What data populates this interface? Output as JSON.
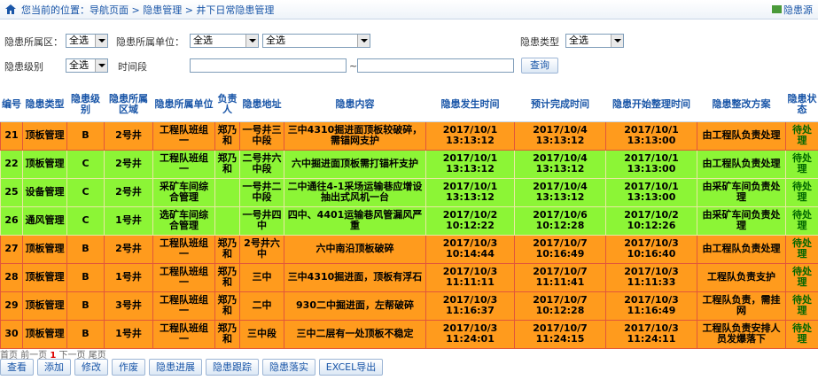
{
  "breadcrumb": "您当前的位置：导航页面 > 隐患管理 > 井下日常隐患管理",
  "top_link": "隐患源",
  "filters": {
    "area_label": "隐患所属区：",
    "area_value": "全选",
    "unit_label": "隐患所属单位：",
    "unit_value1": "全选",
    "unit_value2": "全选",
    "type_label": "隐患类型",
    "type_value": "全选",
    "level_label": "隐患级别",
    "level_value": "全选",
    "period_label": "时间段",
    "range_sep": "~",
    "query_label": "查询"
  },
  "columns": [
    "编号",
    "隐患类型",
    "隐患级别",
    "隐患所属区域",
    "隐患所属单位",
    "负责人",
    "隐患地址",
    "隐患内容",
    "隐患发生时间",
    "预计完成时间",
    "隐患开始整理时间",
    "隐患整改方案",
    "隐患状态"
  ],
  "rows": [
    {
      "style": "orange",
      "cells": [
        "21",
        "顶板管理",
        "B",
        "2号井",
        "工程队班组一",
        "郑乃和",
        "一号井三中段",
        "三中4310掘进面顶板较破碎，需锚网支护",
        "2017/10/1 13:13:12",
        "2017/10/4 13:13:12",
        "2017/10/1 13:13:00",
        "由工程队负责处理",
        "待处理"
      ]
    },
    {
      "style": "green",
      "cells": [
        "22",
        "顶板管理",
        "C",
        "2号井",
        "工程队班组一",
        "郑乃和",
        "二号井六中段",
        "六中掘进面顶板需打锚杆支护",
        "2017/10/1 13:13:12",
        "2017/10/4 13:13:12",
        "2017/10/1 13:13:00",
        "由工程队负责处理",
        "待处理"
      ]
    },
    {
      "style": "green",
      "cells": [
        "25",
        "设备管理",
        "C",
        "2号井",
        "采矿车间综合管理",
        "",
        "一号井二中段",
        "二中通往4-1采场运输巷应增设抽出式风机一台",
        "2017/10/1 13:13:12",
        "2017/10/4 13:13:12",
        "2017/10/1 13:13:00",
        "由采矿车间负责处理",
        "待处理"
      ]
    },
    {
      "style": "green",
      "cells": [
        "26",
        "通风管理",
        "C",
        "1号井",
        "选矿车间综合管理",
        "",
        "一号井四中",
        "四中、4401运输巷风管漏风严重",
        "2017/10/2 10:12:22",
        "2017/10/6 10:12:28",
        "2017/10/2 10:12:26",
        "由采矿车间负责处理",
        "待处理"
      ]
    },
    {
      "style": "orange",
      "cells": [
        "27",
        "顶板管理",
        "B",
        "2号井",
        "工程队班组一",
        "郑乃和",
        "2号井六中",
        "六中南沿顶板破碎",
        "2017/10/3 10:14:44",
        "2017/10/7 10:16:49",
        "2017/10/3 10:16:40",
        "由工程队负责处理",
        "待处理"
      ]
    },
    {
      "style": "orange",
      "cells": [
        "28",
        "顶板管理",
        "B",
        "1号井",
        "工程队班组一",
        "郑乃和",
        "三中",
        "三中4310掘进面，顶板有浮石",
        "2017/10/3 11:11:11",
        "2017/10/7 11:11:41",
        "2017/10/3 11:11:33",
        "工程队负责支护",
        "待处理"
      ]
    },
    {
      "style": "orange",
      "cells": [
        "29",
        "顶板管理",
        "B",
        "3号井",
        "工程队班组一",
        "郑乃和",
        "二中",
        "930二中掘进面，左帮破碎",
        "2017/10/3 11:16:37",
        "2017/10/7 10:12:28",
        "2017/10/3 11:16:49",
        "工程队负责，需挂网",
        "待处理"
      ]
    },
    {
      "style": "orange",
      "cells": [
        "30",
        "顶板管理",
        "B",
        "1号井",
        "工程队班组一",
        "郑乃和",
        "三中段",
        "三中二层有一处顶板不稳定",
        "2017/10/3 11:24:01",
        "2017/10/7 11:24:15",
        "2017/10/3 11:24:11",
        "工程队负责安排人员发爆落下",
        "待处理"
      ]
    }
  ],
  "pager": {
    "first": "首页",
    "prev": "前一页",
    "current": "1",
    "next": "下一页",
    "last": "尾页"
  },
  "actions": [
    "查看",
    "添加",
    "修改",
    "作废",
    "隐患进展",
    "隐患跟踪",
    "隐患落实",
    "EXCEL导出"
  ]
}
